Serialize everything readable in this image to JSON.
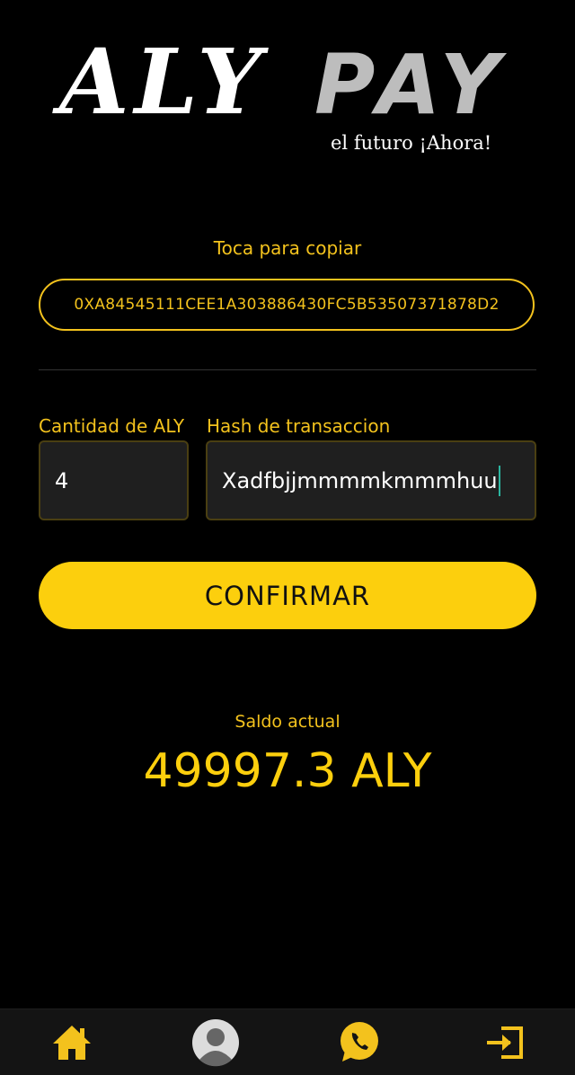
{
  "brand": {
    "name_part1": "ALY",
    "name_part2": "PAY",
    "tagline": "el futuro ¡Ahora!"
  },
  "wallet": {
    "copy_hint": "Toca para copiar",
    "address": "0XA84545111CEE1A303886430FC5B53507371878D2"
  },
  "form": {
    "amount_label": "Cantidad de ALY",
    "amount_value": "4",
    "hash_label": "Hash de transaccion",
    "hash_value": "Xadfbjjmmmmkmmmhuu",
    "confirm_label": "CONFIRMAR"
  },
  "balance": {
    "label": "Saldo actual",
    "value": "49997.3 ALY"
  },
  "nav": {
    "items": [
      "home-icon",
      "user-avatar-icon",
      "whatsapp-icon",
      "logout-icon"
    ]
  },
  "colors": {
    "accent": "#fccf0d",
    "background": "#000000"
  }
}
